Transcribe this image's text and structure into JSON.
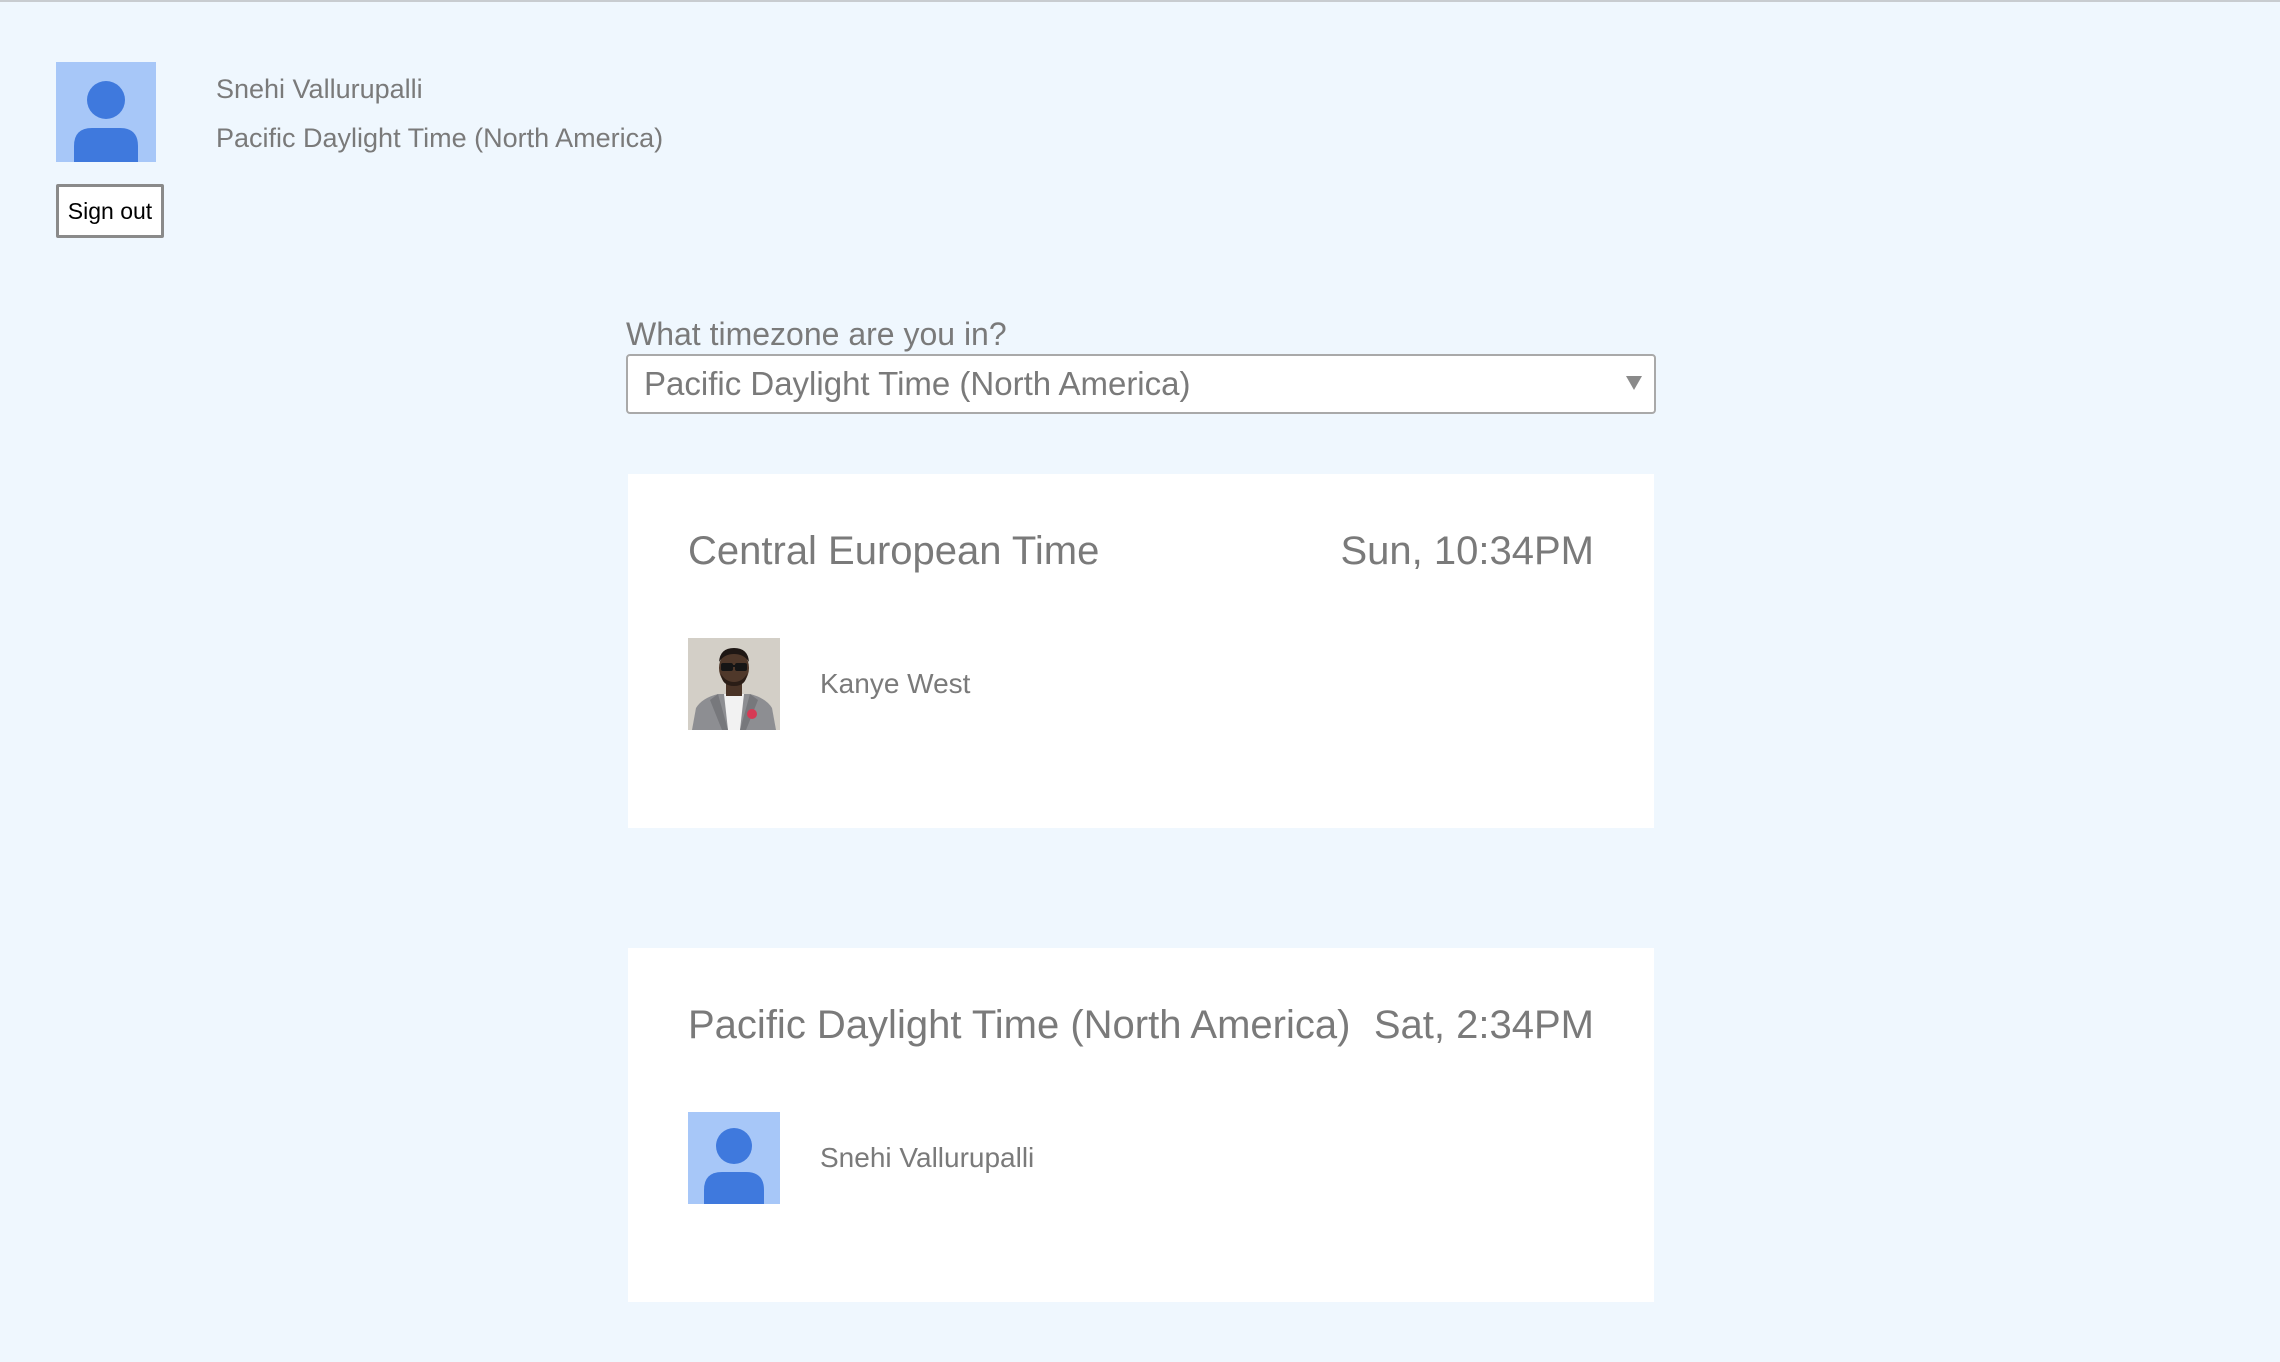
{
  "user": {
    "name": "Snehi Vallurupalli",
    "timezone": "Pacific Daylight Time (North America)",
    "avatar_icon": "person-placeholder-icon",
    "sign_out_label": "Sign out"
  },
  "timezone_picker": {
    "question": "What timezone are you in?",
    "selected": "Pacific Daylight Time (North America)"
  },
  "timezone_cards": [
    {
      "name": "Central European Time",
      "time": "Sun, 10:34PM",
      "members": [
        {
          "name": "Kanye West",
          "avatar": "photo"
        }
      ]
    },
    {
      "name": "Pacific Daylight Time (North America)",
      "time": "Sat, 2:34PM",
      "members": [
        {
          "name": "Snehi Vallurupalli",
          "avatar": "person-placeholder-icon"
        }
      ]
    }
  ],
  "colors": {
    "page_background": "#eff7fe",
    "card_background": "#ffffff",
    "avatar_background": "#a7c7f8",
    "avatar_foreground": "#3f79dd",
    "text": "#7a7a7a"
  }
}
